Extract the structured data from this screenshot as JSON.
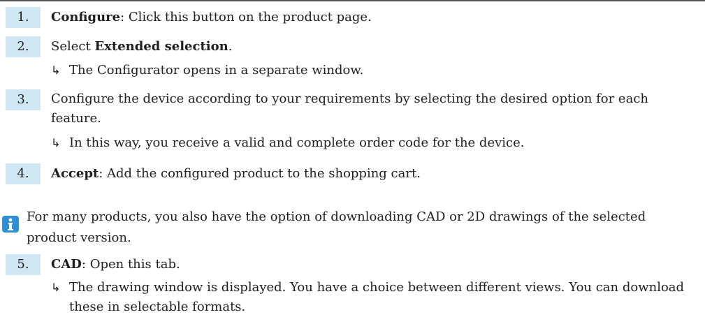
{
  "steps": [
    {
      "number": "1.",
      "bold": "Configure",
      "rest": ": Click this button on the product page."
    },
    {
      "number": "2.",
      "prefix": "Select ",
      "bold": "Extended selection",
      "suffix": ".",
      "result": "The Configurator opens in a separate window."
    },
    {
      "number": "3.",
      "text": "Configure the device according to your requirements by selecting the desired option for each feature.",
      "result": "In this way, you receive a valid and complete order code for the device."
    },
    {
      "number": "4.",
      "bold": "Accept",
      "rest": ": Add the configured product to the shopping cart."
    },
    {
      "number": "5.",
      "bold": "CAD",
      "rest": ": Open this tab.",
      "result": "The drawing window is displayed. You have a choice between different views. You can download these in selectable formats."
    }
  ],
  "info_note": {
    "icon": "info-icon",
    "text": "For many products, you also have the option of downloading CAD or 2D drawings of the selected product version."
  },
  "colors": {
    "number_bg": "#cfe6f3",
    "icon_bg": "#2f8fd6",
    "rule": "#555555",
    "text": "#1f1f1f"
  }
}
